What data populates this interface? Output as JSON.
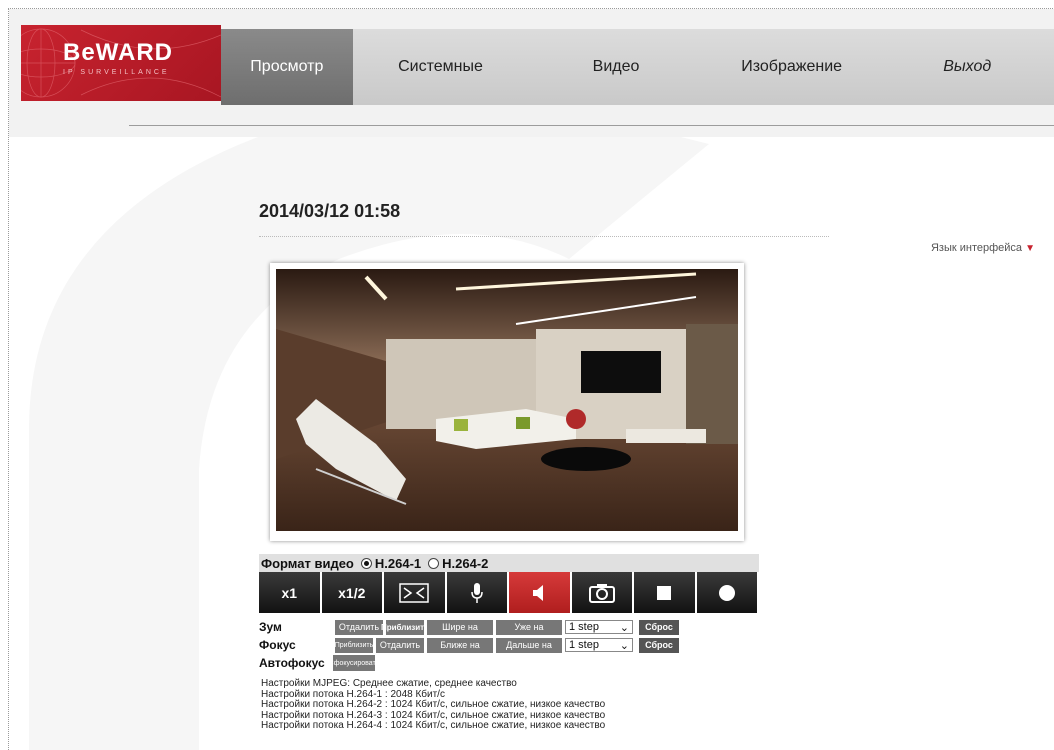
{
  "logo": {
    "text": "BeWARD",
    "subtext": "IP SURVEILLANCE"
  },
  "nav": {
    "items": [
      {
        "label": "Просмотр",
        "active": true
      },
      {
        "label": "Системные"
      },
      {
        "label": "Видео"
      },
      {
        "label": "Изображение"
      },
      {
        "label": "Выход",
        "italic": true
      }
    ]
  },
  "datetime": "2014/03/12 01:58",
  "language": {
    "label": "Язык интерфейса",
    "arrow": "▼"
  },
  "format": {
    "label": "Формат видео",
    "options": [
      {
        "label": "H.264-1",
        "selected": true
      },
      {
        "label": "H.264-2",
        "selected": false
      }
    ]
  },
  "controls": [
    {
      "label": "x1"
    },
    {
      "label": "x1/2"
    },
    {
      "icon": "fullscreen-icon"
    },
    {
      "icon": "microphone-icon"
    },
    {
      "icon": "speaker-icon",
      "active": true
    },
    {
      "icon": "camera-icon"
    },
    {
      "icon": "stop-icon"
    },
    {
      "icon": "record-icon"
    }
  ],
  "zoom": {
    "label": "Зум",
    "out": "Отдалить",
    "in": "Приблизить",
    "wide": "Шире на",
    "narrow": "Уже на",
    "step": "1 step",
    "reset": "Сброс"
  },
  "focus": {
    "label": "Фокус",
    "near": "Приблизить",
    "far": "Отдалить",
    "closer": "Ближе на",
    "further": "Дальше на",
    "step": "1 step",
    "reset": "Сброс"
  },
  "autofocus": {
    "label": "Автофокус",
    "button": "Сфокусировать"
  },
  "stream_info": [
    "Настройки MJPEG: Среднее сжатие, среднее качество",
    "Настройки потока H.264-1 : 2048 Кбит/с",
    "Настройки потока H.264-2 : 1024 Кбит/с, сильное сжатие, низкое качество",
    "Настройки потока H.264-3 : 1024 Кбит/с, сильное сжатие, низкое качество",
    "Настройки потока H.264-4 : 1024 Кбит/с, сильное сжатие, низкое качество"
  ],
  "colors": {
    "brand_red": "#c8232f",
    "active_tab": "#7a7a7a",
    "nav_bg": "#d4d4d4"
  }
}
